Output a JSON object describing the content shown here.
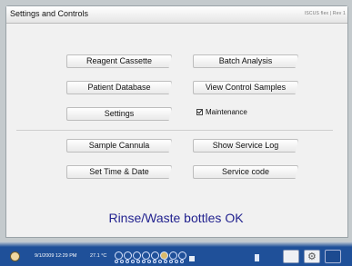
{
  "window": {
    "title": "Settings and Controls",
    "brand": "ISCUS",
    "brand_suffix": "flex | Rev 1"
  },
  "buttons": {
    "reagent_cassette": "Reagent Cassette",
    "batch_analysis": "Batch Analysis",
    "patient_database": "Patient Database",
    "view_control_samples": "View Control Samples",
    "settings": "Settings",
    "sample_cannula": "Sample Cannula",
    "show_service_log": "Show Service Log",
    "set_time_date": "Set Time & Date",
    "service_code": "Service code"
  },
  "maintenance": {
    "label": "Maintenance",
    "checked": true
  },
  "status_message": "Rinse/Waste bottles OK",
  "taskbar": {
    "datetime": "9/1/2009 12:29 PM",
    "temperature": "27.1 °C"
  },
  "colors": {
    "status_text": "#23238f",
    "taskbar": "#1f5099"
  }
}
